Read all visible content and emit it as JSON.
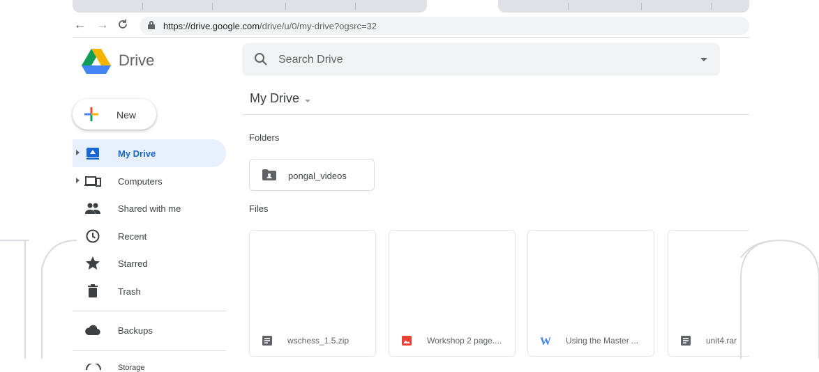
{
  "browser": {
    "url_host": "https://drive.google.com",
    "url_path": "/drive/u/0/my-drive?ogsrc=32"
  },
  "app": {
    "name": "Drive"
  },
  "search": {
    "placeholder": "Search Drive"
  },
  "new_button": {
    "label": "New"
  },
  "sidebar": {
    "items": [
      {
        "label": "My Drive",
        "icon": "my-drive-icon",
        "active": true
      },
      {
        "label": "Computers",
        "icon": "computers-icon"
      },
      {
        "label": "Shared with me",
        "icon": "shared-icon"
      },
      {
        "label": "Recent",
        "icon": "clock-icon"
      },
      {
        "label": "Starred",
        "icon": "star-icon"
      },
      {
        "label": "Trash",
        "icon": "trash-icon"
      },
      {
        "label": "Backups",
        "icon": "cloud-icon"
      },
      {
        "label": "Storage",
        "icon": "storage-icon"
      }
    ]
  },
  "main": {
    "title": "My Drive",
    "folders_label": "Folders",
    "files_label": "Files",
    "folders": [
      {
        "name": "pongal_videos"
      }
    ],
    "files": [
      {
        "name": "wschess_1.5.zip",
        "type": "archive-icon"
      },
      {
        "name": "Workshop 2 page....",
        "type": "image-icon"
      },
      {
        "name": "Using the Master ...",
        "type": "word-icon"
      },
      {
        "name": "unit4.rar",
        "type": "archive-icon"
      }
    ]
  },
  "colors": {
    "accent": "#1967d2",
    "active_bg": "#e8f0fe",
    "logo_green": "#0f9d58",
    "logo_yellow": "#f4b400",
    "logo_blue": "#4285f4",
    "image_red": "#ea4335"
  }
}
